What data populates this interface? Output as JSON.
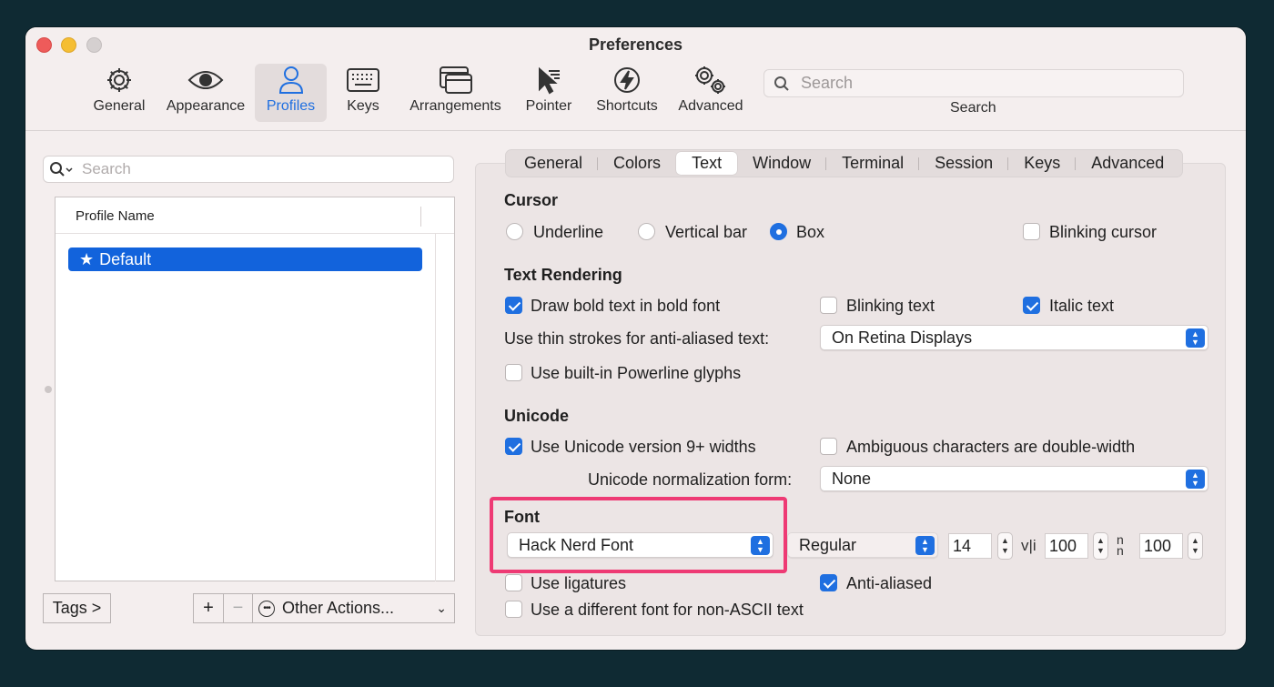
{
  "window": {
    "title": "Preferences"
  },
  "toolbar": {
    "items": [
      {
        "label": "General",
        "icon": "gear-icon"
      },
      {
        "label": "Appearance",
        "icon": "eye-icon"
      },
      {
        "label": "Profiles",
        "icon": "person-icon",
        "active": true
      },
      {
        "label": "Keys",
        "icon": "keyboard-icon"
      },
      {
        "label": "Arrangements",
        "icon": "windows-icon"
      },
      {
        "label": "Pointer",
        "icon": "pointer-icon"
      },
      {
        "label": "Shortcuts",
        "icon": "bolt-icon"
      },
      {
        "label": "Advanced",
        "icon": "gears-icon"
      }
    ],
    "search": {
      "placeholder": "Search",
      "label": "Search"
    }
  },
  "profiles": {
    "search_placeholder": "Search",
    "column_header": "Profile Name",
    "items": [
      {
        "name": "Default",
        "starred": true,
        "selected": true
      }
    ],
    "tags_button": "Tags >",
    "add_button": "+",
    "remove_button": "−",
    "other_actions": "Other Actions..."
  },
  "tabs": [
    "General",
    "Colors",
    "Text",
    "Window",
    "Terminal",
    "Session",
    "Keys",
    "Advanced"
  ],
  "active_tab": "Text",
  "accent_color": "#1f6fe0",
  "highlight_color": "#ee3a74",
  "cursor": {
    "title": "Cursor",
    "options": [
      "Underline",
      "Vertical bar",
      "Box"
    ],
    "selected": "Box",
    "blinking_label": "Blinking cursor",
    "blinking": false
  },
  "text_rendering": {
    "title": "Text Rendering",
    "bold_label": "Draw bold text in bold font",
    "bold": true,
    "blinking_text_label": "Blinking text",
    "blinking_text": false,
    "italic_label": "Italic text",
    "italic": true,
    "thin_strokes_label": "Use thin strokes for anti-aliased text:",
    "thin_strokes_value": "On Retina Displays",
    "powerline_label": "Use built-in Powerline glyphs",
    "powerline": false
  },
  "unicode": {
    "title": "Unicode",
    "v9_label": "Use Unicode version 9+ widths",
    "v9": true,
    "ambiguous_label": "Ambiguous characters are double-width",
    "ambiguous": false,
    "normalization_label": "Unicode normalization form:",
    "normalization_value": "None"
  },
  "font": {
    "title": "Font",
    "family": "Hack Nerd Font",
    "style": "Regular",
    "size": "14",
    "h_spacing_glyph": "v|i",
    "h_spacing": "100",
    "v_spacing_glyph": "n/n",
    "v_spacing": "100",
    "ligatures_label": "Use ligatures",
    "ligatures": false,
    "antialiased_label": "Anti-aliased",
    "antialiased": true,
    "non_ascii_label": "Use a different font for non-ASCII text",
    "non_ascii": false
  }
}
